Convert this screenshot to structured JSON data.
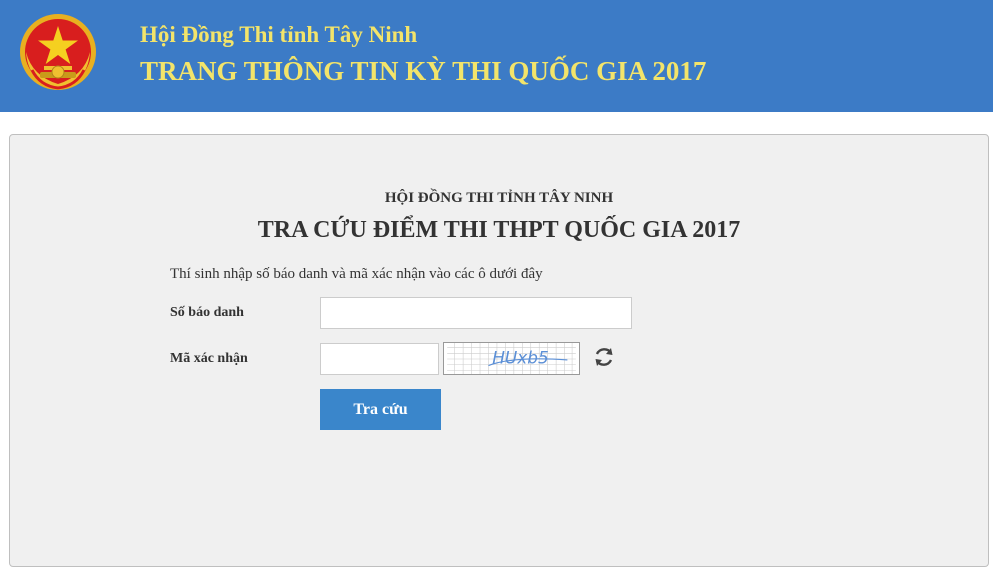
{
  "header": {
    "emblem_icon": "vietnam-national-emblem-icon",
    "line1": "Hội Đồng Thi tỉnh Tây Ninh",
    "line2": "TRANG THÔNG TIN KỲ THI QUỐC GIA 2017"
  },
  "form": {
    "subtitle": "HỘI ĐỒNG THI TỈNH TÂY NINH",
    "title": "TRA CỨU ĐIỂM THI THPT QUỐC GIA 2017",
    "instruction": "Thí sinh nhập số báo danh và mã xác nhận vào các ô dưới đây",
    "sbd_label": "Số báo danh",
    "sbd_value": "",
    "captcha_label": "Mã xác nhận",
    "captcha_value": "",
    "captcha_text": "HUxb5",
    "refresh_icon": "refresh-icon",
    "submit_label": "Tra cứu"
  },
  "colors": {
    "header_bg": "#3c7bc6",
    "header_text": "#f3e46a",
    "button_bg": "#3a86cb",
    "panel_bg": "#f0f0f0"
  }
}
